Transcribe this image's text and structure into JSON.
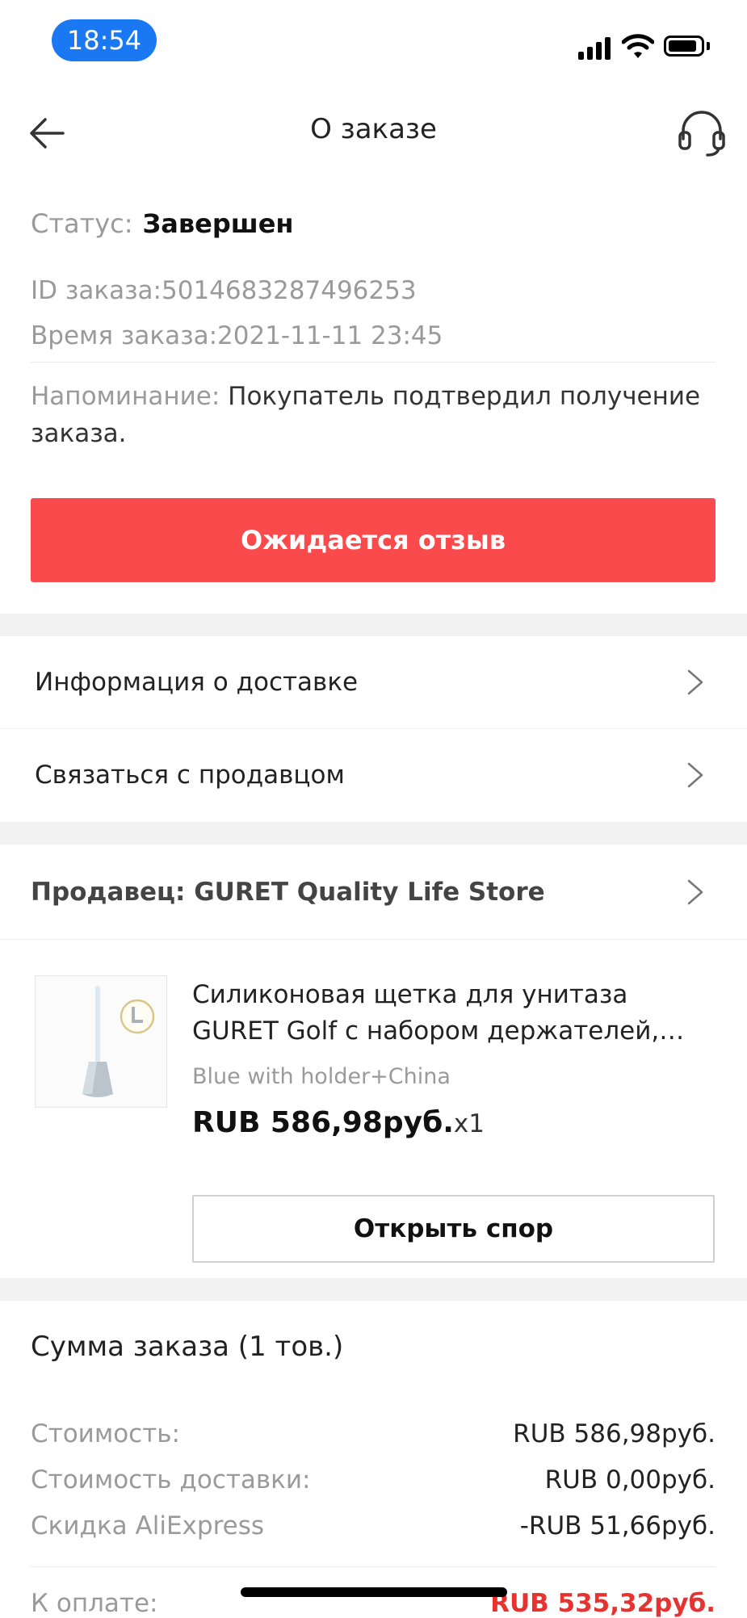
{
  "status_bar": {
    "time": "18:54"
  },
  "header": {
    "title": "О заказе",
    "back_icon": "back-arrow-icon",
    "support_icon": "headset-icon"
  },
  "order": {
    "status_label": "Статус:",
    "status_value": "Завершен",
    "id_text": "ID заказа:5014683287496253",
    "time_text": "Время заказа:2021-11-11 23:45",
    "reminder_label": "Напоминание:",
    "reminder_text": "Покупатель подтвердил получение заказа."
  },
  "primary_action": {
    "label": "Ожидается отзыв",
    "color": "#fa4a4c"
  },
  "menu": {
    "delivery_label": "Информация о доставке",
    "contact_label": "Связаться с продавцом"
  },
  "seller": {
    "label": "Продавец: GURET Quality Life Store"
  },
  "product": {
    "title": "Силиконовая щетка для унитаза GURET Golf с набором держателей, щетка для...",
    "variant": "Blue with holder+China",
    "price": "RUB 586,98руб.",
    "qty": "x1",
    "dispute_label": "Открыть спор"
  },
  "summary": {
    "title": "Сумма заказа (1 тов.)",
    "rows": [
      {
        "label": "Стоимость:",
        "value": "RUB 586,98руб."
      },
      {
        "label": "Стоимость доставки:",
        "value": "RUB 0,00руб."
      },
      {
        "label": "Скидка AliExpress",
        "value": "-RUB 51,66руб."
      }
    ],
    "pay_label": "К оплате:",
    "pay_value": "RUB 535,32руб.",
    "pay_color": "#e8322f"
  }
}
